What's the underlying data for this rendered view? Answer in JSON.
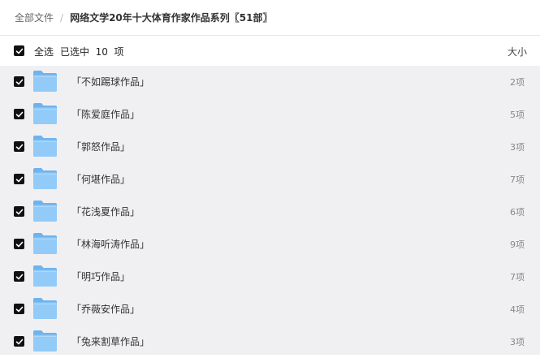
{
  "breadcrumb": {
    "root": "全部文件",
    "separator": "/",
    "current": "网络文学20年十大体育作家作品系列〖51部〗"
  },
  "list_header": {
    "select_all_label": "全选",
    "selected_text": "已选中  10  项",
    "size_label": "大小",
    "select_all_checked": true
  },
  "files": [
    {
      "name": "「不如踢球作品」",
      "count": "2项",
      "checked": true
    },
    {
      "name": "「陈爱庭作品」",
      "count": "5项",
      "checked": true
    },
    {
      "name": "「郭怒作品」",
      "count": "3项",
      "checked": true
    },
    {
      "name": "「何堪作品」",
      "count": "7项",
      "checked": true
    },
    {
      "name": "「花浅夏作品」",
      "count": "6项",
      "checked": true
    },
    {
      "name": "「林海听涛作品」",
      "count": "9项",
      "checked": true
    },
    {
      "name": "「明巧作品」",
      "count": "7项",
      "checked": true
    },
    {
      "name": "「乔薇安作品」",
      "count": "4项",
      "checked": true
    },
    {
      "name": "「兔来割草作品」",
      "count": "3项",
      "checked": true
    }
  ],
  "icons": {
    "checkbox": "checkbox-checked-icon",
    "folder": "folder-icon"
  },
  "colors": {
    "checkbox_fill": "#111111",
    "folder_blue": "#8cc6f7",
    "list_background": "#f0f0f2"
  }
}
